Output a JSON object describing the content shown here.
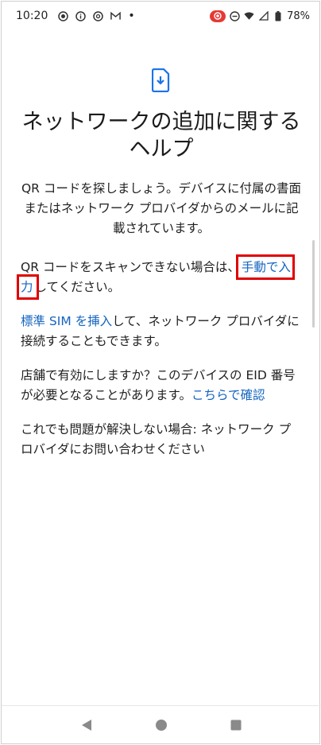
{
  "status": {
    "time": "10:20",
    "dot": "•",
    "battery": "78%"
  },
  "page": {
    "title": "ネットワークの追加に関するヘルプ",
    "p1": "QR コードを探しましょう。デバイスに付属の書面またはネットワーク プロバイダからのメールに記載されています。",
    "p2_prefix": "QR コードをスキャンできない場合は、",
    "p2_link": "手動で入力",
    "p2_suffix": "してください。",
    "p3_link": "標準 SIM を挿入",
    "p3_suffix": "して、ネットワーク プロバイダに接続することもできます。",
    "p4_prefix": "店舗で有効にしますか？このデバイスの EID 番号が必要となることがあります。",
    "p4_link": "こちらで確認",
    "p5": "これでも問題が解決しない場合: ネットワーク プロバイダにお問い合わせください"
  },
  "icons": {
    "hero": "sim-download-icon",
    "back": "back-triangle-icon",
    "home": "home-circle-icon",
    "recents": "recents-square-icon"
  },
  "colors": {
    "link": "#1565c0",
    "highlight": "#e00000",
    "accent": "#1a73e8"
  }
}
